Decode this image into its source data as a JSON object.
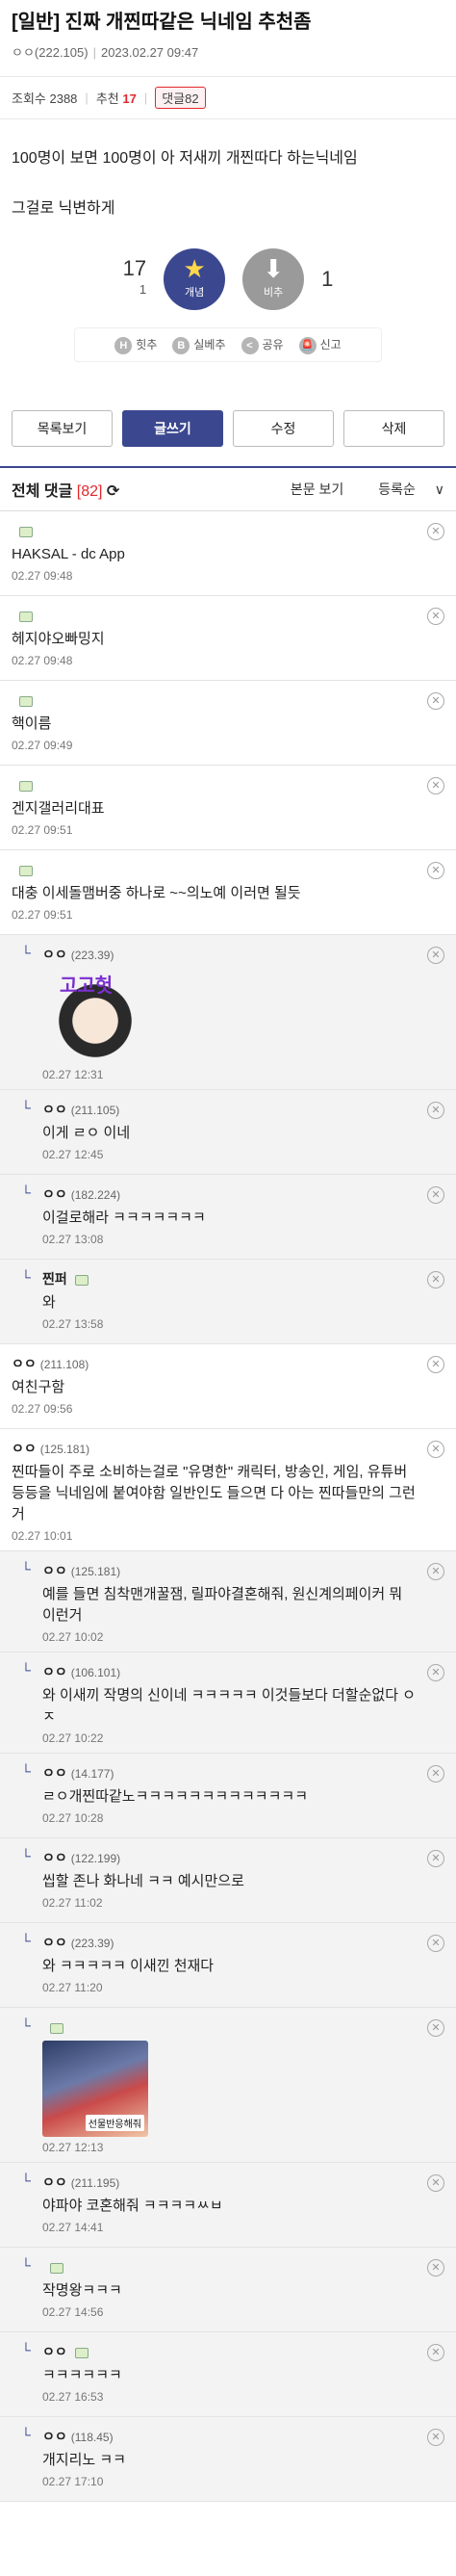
{
  "post": {
    "title": "[일반] 진짜 개찐따같은 닉네임 추천좀",
    "author": "ㅇㅇ(222.105)",
    "date": "2023.02.27 09:47",
    "views_label": "조회수 2388",
    "rec_label": "추천",
    "rec_count": "17",
    "comment_label": "댓글82",
    "body": [
      "100명이 보면 100명이 아 저새끼 개찐따다 하는닉네임",
      "그걸로 닉변하게"
    ]
  },
  "vote": {
    "up": "17",
    "up_sub": "1",
    "up_label": "개념",
    "down_label": "비추",
    "down": "1"
  },
  "tools": [
    {
      "icon": "H",
      "label": "힛추"
    },
    {
      "icon": "B",
      "label": "실베추"
    },
    {
      "icon": "<",
      "label": "공유"
    },
    {
      "icon": "!",
      "label": "신고"
    }
  ],
  "buttons": {
    "list": "목록보기",
    "write": "글쓰기",
    "edit": "수정",
    "delete": "삭제"
  },
  "comments_header": {
    "title": "전체 댓글",
    "count": "[82]",
    "view_original": "본문 보기",
    "sort": "등록순"
  },
  "comments": [
    {
      "name": "",
      "ip": "",
      "badge": true,
      "text": "HAKSAL - dc App",
      "time": "02.27 09:48"
    },
    {
      "name": "",
      "ip": "",
      "badge": true,
      "text": "헤지야오빠밍지",
      "time": "02.27 09:48"
    },
    {
      "name": "",
      "ip": "",
      "badge": true,
      "text": "핵이름",
      "time": "02.27 09:49"
    },
    {
      "name": "",
      "ip": "",
      "badge": true,
      "text": "겐지갤러리대표",
      "time": "02.27 09:51"
    },
    {
      "name": "",
      "ip": "",
      "badge": true,
      "text": "대충 이세돌맴버중 하나로 ~~의노예 이러면 될듯",
      "time": "02.27 09:51"
    },
    {
      "reply": true,
      "name": "ㅇㅇ",
      "ip": "(223.39)",
      "image": "a",
      "image_label": "고고헛",
      "text": "",
      "time": "02.27 12:31"
    },
    {
      "reply": true,
      "name": "ㅇㅇ",
      "ip": "(211.105)",
      "text": "이게 ㄹㅇ 이네",
      "time": "02.27 12:45"
    },
    {
      "reply": true,
      "name": "ㅇㅇ",
      "ip": "(182.224)",
      "text": "이걸로해라 ㅋㅋㅋㅋㅋㅋㅋ",
      "time": "02.27 13:08"
    },
    {
      "reply": true,
      "name": "찐퍼",
      "ip": "",
      "badge": true,
      "text": "와",
      "time": "02.27 13:58"
    },
    {
      "name": "ㅇㅇ",
      "ip": "(211.108)",
      "text": "여친구함",
      "time": "02.27 09:56"
    },
    {
      "name": "ㅇㅇ",
      "ip": "(125.181)",
      "text": "찐따들이 주로 소비하는걸로 \"유명한\" 캐릭터, 방송인, 게임, 유튜버 등등을 닉네임에 붙여야함 일반인도 들으면 다 아는 찐따들만의 그런거",
      "time": "02.27 10:01"
    },
    {
      "reply": true,
      "name": "ㅇㅇ",
      "ip": "(125.181)",
      "text": "예를 들면 침착맨개꿀잼, 릴파야결혼해줘, 원신계의페이커 뭐 이런거",
      "time": "02.27 10:02"
    },
    {
      "reply": true,
      "name": "ㅇㅇ",
      "ip": "(106.101)",
      "text": "와 이새끼 작명의 신이네 ㅋㅋㅋㅋㅋ 이것들보다 더할순없다 ㅇㅈ",
      "time": "02.27 10:22"
    },
    {
      "reply": true,
      "name": "ㅇㅇ",
      "ip": "(14.177)",
      "text": "ㄹㅇ개찐따같노ㅋㅋㅋㅋㅋㅋㅋㅋㅋㅋㅋㅋㅋ",
      "time": "02.27 10:28"
    },
    {
      "reply": true,
      "name": "ㅇㅇ",
      "ip": "(122.199)",
      "text": "씹할 존나 화나네 ㅋㅋ 예시만으로",
      "time": "02.27 11:02"
    },
    {
      "reply": true,
      "name": "ㅇㅇ",
      "ip": "(223.39)",
      "text": "와 ㅋㅋㅋㅋㅋ 이새낀 천재다",
      "time": "02.27 11:20"
    },
    {
      "reply": true,
      "name": "",
      "ip": "",
      "badge": true,
      "image": "b",
      "image_label": "선물반응해줘",
      "text": "",
      "time": "02.27 12:13"
    },
    {
      "reply": true,
      "name": "ㅇㅇ",
      "ip": "(211.195)",
      "text": "야파야 코혼해줘 ㅋㅋㅋㅋㅆㅂ",
      "time": "02.27 14:41"
    },
    {
      "reply": true,
      "name": "",
      "ip": "",
      "badge": true,
      "text": "작명왕ㅋㅋㅋ",
      "time": "02.27 14:56"
    },
    {
      "reply": true,
      "name": "ㅇㅇ",
      "ip": "",
      "badge": true,
      "text": "ㅋㅋㅋㅋㅋㅋ",
      "time": "02.27 16:53"
    },
    {
      "reply": true,
      "name": "ㅇㅇ",
      "ip": "(118.45)",
      "text": "개지리노 ㅋㅋ",
      "time": "02.27 17:10"
    }
  ]
}
